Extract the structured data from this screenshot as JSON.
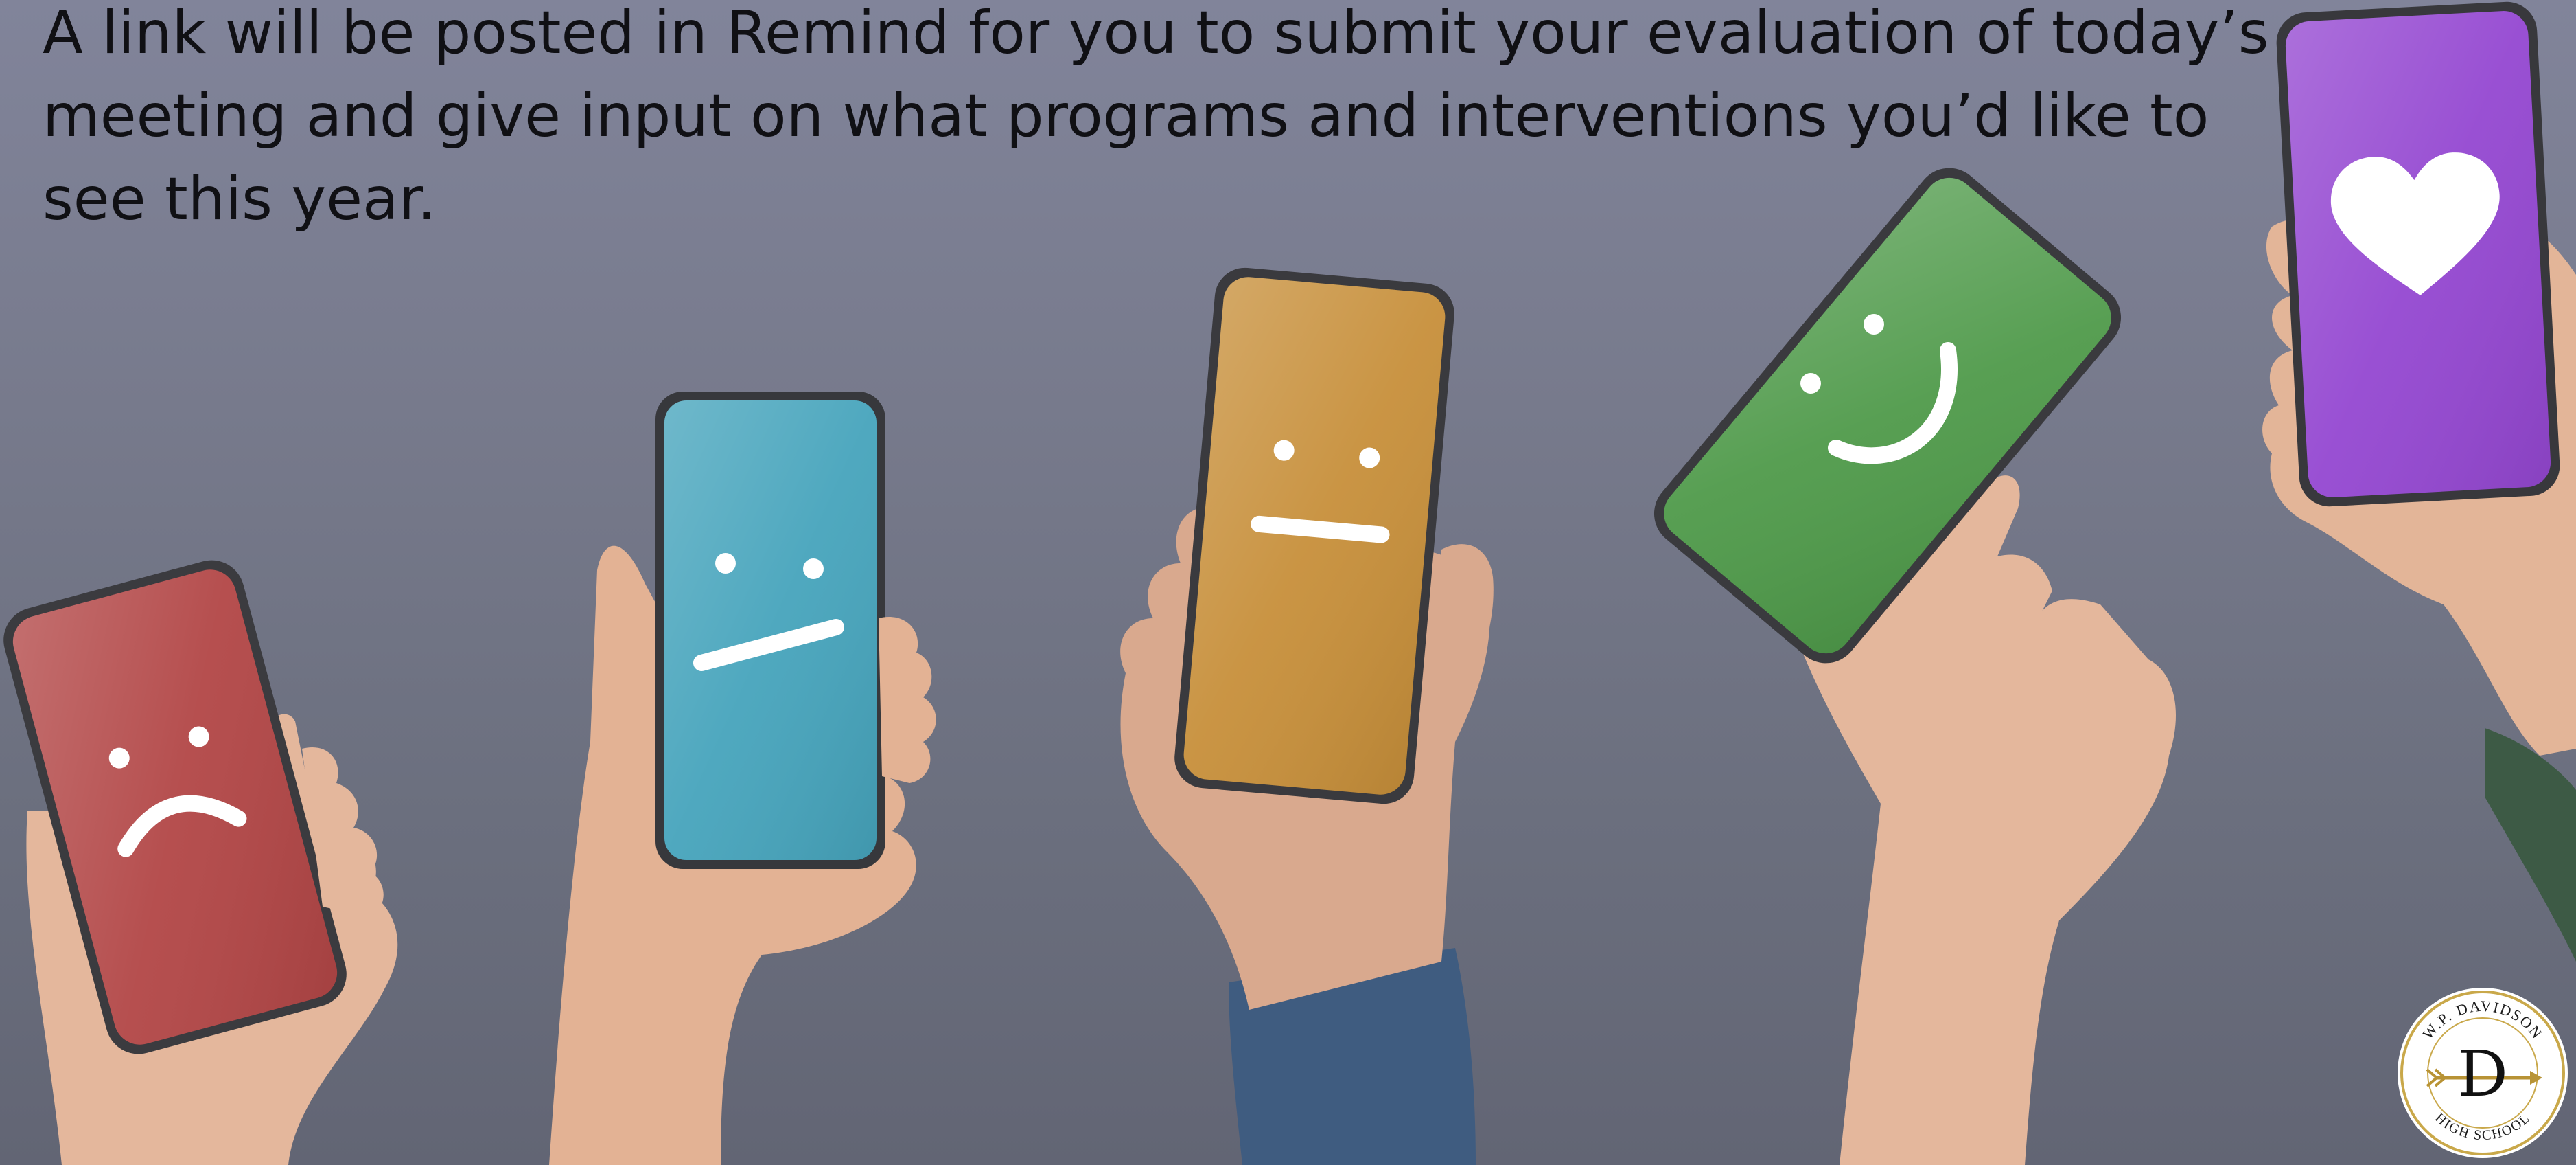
{
  "message": "A link will be posted in Remind for you to submit your evaluation of today’s meeting and give input on what programs and interventions you’d like to see this year.",
  "phones": [
    {
      "rating": "sad",
      "icon": "sad-face-icon",
      "color": "#b24646"
    },
    {
      "rating": "unsure",
      "icon": "unsure-face-icon",
      "color": "#46a4bc"
    },
    {
      "rating": "neutral",
      "icon": "neutral-face-icon",
      "color": "#c78f3a"
    },
    {
      "rating": "happy",
      "icon": "smile-face-icon",
      "color": "#4f9a4a"
    },
    {
      "rating": "love",
      "icon": "heart-icon",
      "color": "#9447d1"
    }
  ],
  "logo": {
    "text_top": "W.P. DAVIDSON",
    "text_bottom": "HIGH SCHOOL",
    "letter": "D"
  },
  "colors": {
    "background": "#787b8d",
    "text": "#101014",
    "skin": "#e6bca3",
    "sleeve": "#3f5c80"
  }
}
